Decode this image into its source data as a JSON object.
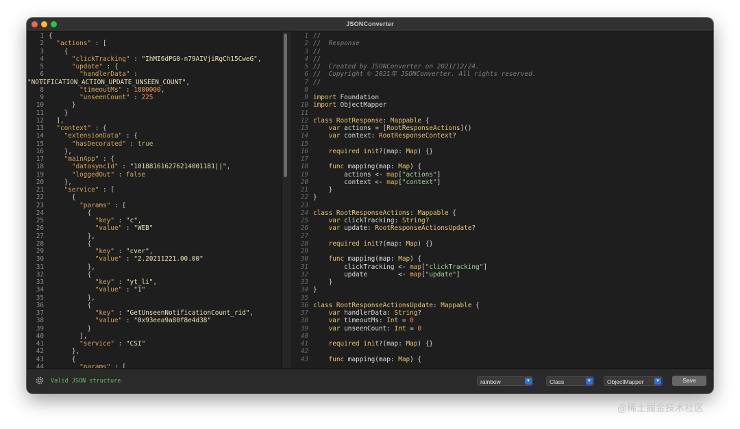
{
  "window": {
    "title": "JSONConverter"
  },
  "json_lines": [
    [
      {
        "t": "{"
      }
    ],
    [
      {
        "t": "  "
      },
      {
        "t": "\"actions\"",
        "c": "k"
      },
      {
        "t": " : ["
      }
    ],
    [
      {
        "t": "    {"
      }
    ],
    [
      {
        "t": "      "
      },
      {
        "t": "\"clickTracking\"",
        "c": "k"
      },
      {
        "t": " : "
      },
      {
        "t": "\"IhMI6dPG0-n79AIVjiRgCh15CweG\"",
        "c": "s"
      },
      {
        "t": ","
      }
    ],
    [
      {
        "t": "      "
      },
      {
        "t": "\"update\"",
        "c": "k"
      },
      {
        "t": " : {"
      }
    ],
    [
      {
        "t": "        "
      },
      {
        "t": "\"handlerData\"",
        "c": "k"
      },
      {
        "t": " :"
      }
    ],
    [
      {
        "t": "\"NOTIFICATION_ACTION_UPDATE_UNSEEN_COUNT\"",
        "c": "s",
        "abs": 1
      },
      {
        "t": ",",
        "abs": 1
      }
    ],
    [
      {
        "t": "        "
      },
      {
        "t": "\"timeoutMs\"",
        "c": "k"
      },
      {
        "t": " : "
      },
      {
        "t": "1800000",
        "c": "n"
      },
      {
        "t": ","
      }
    ],
    [
      {
        "t": "        "
      },
      {
        "t": "\"unseenCount\"",
        "c": "k"
      },
      {
        "t": " : "
      },
      {
        "t": "225",
        "c": "n"
      }
    ],
    [
      {
        "t": "      }"
      }
    ],
    [
      {
        "t": "    }"
      }
    ],
    [
      {
        "t": "  ],"
      }
    ],
    [
      {
        "t": "  "
      },
      {
        "t": "\"context\"",
        "c": "k"
      },
      {
        "t": " : {"
      }
    ],
    [
      {
        "t": "    "
      },
      {
        "t": "\"extensionData\"",
        "c": "k"
      },
      {
        "t": " : {"
      }
    ],
    [
      {
        "t": "      "
      },
      {
        "t": "\"hasDecorated\"",
        "c": "k"
      },
      {
        "t": " : "
      },
      {
        "t": "true",
        "c": "b"
      }
    ],
    [
      {
        "t": "    },"
      }
    ],
    [
      {
        "t": "    "
      },
      {
        "t": "\"mainApp\"",
        "c": "k"
      },
      {
        "t": " : {"
      }
    ],
    [
      {
        "t": "      "
      },
      {
        "t": "\"datasyncId\"",
        "c": "k"
      },
      {
        "t": " : "
      },
      {
        "t": "\"101881616276214001181||\"",
        "c": "s"
      },
      {
        "t": ","
      }
    ],
    [
      {
        "t": "      "
      },
      {
        "t": "\"loggedOut\"",
        "c": "k"
      },
      {
        "t": " : "
      },
      {
        "t": "false",
        "c": "b"
      }
    ],
    [
      {
        "t": "    },"
      }
    ],
    [
      {
        "t": "    "
      },
      {
        "t": "\"service\"",
        "c": "k"
      },
      {
        "t": " : ["
      }
    ],
    [
      {
        "t": "      {"
      }
    ],
    [
      {
        "t": "        "
      },
      {
        "t": "\"params\"",
        "c": "k"
      },
      {
        "t": " : ["
      }
    ],
    [
      {
        "t": "          {"
      }
    ],
    [
      {
        "t": "            "
      },
      {
        "t": "\"key\"",
        "c": "k"
      },
      {
        "t": " : "
      },
      {
        "t": "\"c\"",
        "c": "s"
      },
      {
        "t": ","
      }
    ],
    [
      {
        "t": "            "
      },
      {
        "t": "\"value\"",
        "c": "k"
      },
      {
        "t": " : "
      },
      {
        "t": "\"WEB\"",
        "c": "s"
      }
    ],
    [
      {
        "t": "          },"
      }
    ],
    [
      {
        "t": "          {"
      }
    ],
    [
      {
        "t": "            "
      },
      {
        "t": "\"key\"",
        "c": "k"
      },
      {
        "t": " : "
      },
      {
        "t": "\"cver\"",
        "c": "s"
      },
      {
        "t": ","
      }
    ],
    [
      {
        "t": "            "
      },
      {
        "t": "\"value\"",
        "c": "k"
      },
      {
        "t": " : "
      },
      {
        "t": "\"2.20211221.00.00\"",
        "c": "s"
      }
    ],
    [
      {
        "t": "          },"
      }
    ],
    [
      {
        "t": "          {"
      }
    ],
    [
      {
        "t": "            "
      },
      {
        "t": "\"key\"",
        "c": "k"
      },
      {
        "t": " : "
      },
      {
        "t": "\"yt_li\"",
        "c": "s"
      },
      {
        "t": ","
      }
    ],
    [
      {
        "t": "            "
      },
      {
        "t": "\"value\"",
        "c": "k"
      },
      {
        "t": " : "
      },
      {
        "t": "\"1\"",
        "c": "s"
      }
    ],
    [
      {
        "t": "          },"
      }
    ],
    [
      {
        "t": "          {"
      }
    ],
    [
      {
        "t": "            "
      },
      {
        "t": "\"key\"",
        "c": "k"
      },
      {
        "t": " : "
      },
      {
        "t": "\"GetUnseenNotificationCount_rid\"",
        "c": "s"
      },
      {
        "t": ","
      }
    ],
    [
      {
        "t": "            "
      },
      {
        "t": "\"value\"",
        "c": "k"
      },
      {
        "t": " : "
      },
      {
        "t": "\"0x93eea9a80f8e4d38\"",
        "c": "s"
      }
    ],
    [
      {
        "t": "          }"
      }
    ],
    [
      {
        "t": "        ],"
      }
    ],
    [
      {
        "t": "        "
      },
      {
        "t": "\"service\"",
        "c": "k"
      },
      {
        "t": " : "
      },
      {
        "t": "\"CSI\"",
        "c": "s"
      }
    ],
    [
      {
        "t": "      },"
      }
    ],
    [
      {
        "t": "      {"
      }
    ],
    [
      {
        "t": "        "
      },
      {
        "t": "\"params\"",
        "c": "k"
      },
      {
        "t": " : ["
      }
    ]
  ],
  "swift_lines": [
    [
      {
        "t": "//",
        "c": "cm"
      }
    ],
    [
      {
        "t": "//  Response",
        "c": "cm"
      }
    ],
    [
      {
        "t": "//",
        "c": "cm"
      }
    ],
    [
      {
        "t": "//",
        "c": "cm"
      }
    ],
    [
      {
        "t": "//  Created by JSONConverter on 2021/12/24.",
        "c": "cm"
      }
    ],
    [
      {
        "t": "//  Copyright © 2021年 JSONConverter. All rights reserved.",
        "c": "cm"
      }
    ],
    [
      {
        "t": "//",
        "c": "cm"
      }
    ],
    [],
    [
      {
        "t": "import",
        "c": "kw"
      },
      {
        "t": " Foundation"
      }
    ],
    [
      {
        "t": "import",
        "c": "kw"
      },
      {
        "t": " ObjectMapper"
      }
    ],
    [],
    [
      {
        "t": "class",
        "c": "kw"
      },
      {
        "t": " "
      },
      {
        "t": "RootResponse",
        "c": "ty"
      },
      {
        "t": ": "
      },
      {
        "t": "Mappable",
        "c": "ty"
      },
      {
        "t": " {"
      }
    ],
    [
      {
        "t": "    "
      },
      {
        "t": "var",
        "c": "kw"
      },
      {
        "t": " actions = ["
      },
      {
        "t": "RootResponseActions",
        "c": "ty"
      },
      {
        "t": "]()"
      }
    ],
    [
      {
        "t": "    "
      },
      {
        "t": "var",
        "c": "kw"
      },
      {
        "t": " context: "
      },
      {
        "t": "RootResponseContext",
        "c": "ty"
      },
      {
        "t": "?"
      }
    ],
    [],
    [
      {
        "t": "    "
      },
      {
        "t": "required",
        "c": "kw"
      },
      {
        "t": " "
      },
      {
        "t": "init",
        "c": "kw"
      },
      {
        "t": "?(map: "
      },
      {
        "t": "Map",
        "c": "ty"
      },
      {
        "t": ") {}"
      }
    ],
    [],
    [
      {
        "t": "    "
      },
      {
        "t": "func",
        "c": "kw"
      },
      {
        "t": " mapping(map: "
      },
      {
        "t": "Map",
        "c": "ty"
      },
      {
        "t": ") {"
      }
    ],
    [
      {
        "t": "        actions <- "
      },
      {
        "t": "map",
        "c": "fn"
      },
      {
        "t": "["
      },
      {
        "t": "\"actions\"",
        "c": "st"
      },
      {
        "t": "]"
      }
    ],
    [
      {
        "t": "        context <- "
      },
      {
        "t": "map",
        "c": "fn"
      },
      {
        "t": "["
      },
      {
        "t": "\"context\"",
        "c": "st"
      },
      {
        "t": "]"
      }
    ],
    [
      {
        "t": "    }"
      }
    ],
    [
      {
        "t": "}"
      }
    ],
    [],
    [
      {
        "t": "class",
        "c": "kw"
      },
      {
        "t": " "
      },
      {
        "t": "RootResponseActions",
        "c": "ty"
      },
      {
        "t": ": "
      },
      {
        "t": "Mappable",
        "c": "ty"
      },
      {
        "t": " {"
      }
    ],
    [
      {
        "t": "    "
      },
      {
        "t": "var",
        "c": "kw"
      },
      {
        "t": " clickTracking: "
      },
      {
        "t": "String",
        "c": "ty"
      },
      {
        "t": "?"
      }
    ],
    [
      {
        "t": "    "
      },
      {
        "t": "var",
        "c": "kw"
      },
      {
        "t": " update: "
      },
      {
        "t": "RootResponseActionsUpdate",
        "c": "ty"
      },
      {
        "t": "?"
      }
    ],
    [],
    [
      {
        "t": "    "
      },
      {
        "t": "required",
        "c": "kw"
      },
      {
        "t": " "
      },
      {
        "t": "init",
        "c": "kw"
      },
      {
        "t": "?(map: "
      },
      {
        "t": "Map",
        "c": "ty"
      },
      {
        "t": ") {}"
      }
    ],
    [],
    [
      {
        "t": "    "
      },
      {
        "t": "func",
        "c": "kw"
      },
      {
        "t": " mapping(map: "
      },
      {
        "t": "Map",
        "c": "ty"
      },
      {
        "t": ") {"
      }
    ],
    [
      {
        "t": "        clickTracking <- "
      },
      {
        "t": "map",
        "c": "fn"
      },
      {
        "t": "["
      },
      {
        "t": "\"clickTracking\"",
        "c": "st"
      },
      {
        "t": "]"
      }
    ],
    [
      {
        "t": "        update        <- "
      },
      {
        "t": "map",
        "c": "fn"
      },
      {
        "t": "["
      },
      {
        "t": "\"update\"",
        "c": "st"
      },
      {
        "t": "]"
      }
    ],
    [
      {
        "t": "    }"
      }
    ],
    [
      {
        "t": "}"
      }
    ],
    [],
    [
      {
        "t": "class",
        "c": "kw"
      },
      {
        "t": " "
      },
      {
        "t": "RootResponseActionsUpdate",
        "c": "ty"
      },
      {
        "t": ": "
      },
      {
        "t": "Mappable",
        "c": "ty"
      },
      {
        "t": " {"
      }
    ],
    [
      {
        "t": "    "
      },
      {
        "t": "var",
        "c": "kw"
      },
      {
        "t": " handlerData: "
      },
      {
        "t": "String",
        "c": "ty"
      },
      {
        "t": "?"
      }
    ],
    [
      {
        "t": "    "
      },
      {
        "t": "var",
        "c": "kw"
      },
      {
        "t": " timeoutMs: "
      },
      {
        "t": "Int",
        "c": "ty"
      },
      {
        "t": " = "
      },
      {
        "t": "0",
        "c": "nb"
      }
    ],
    [
      {
        "t": "    "
      },
      {
        "t": "var",
        "c": "kw"
      },
      {
        "t": " unseenCount: "
      },
      {
        "t": "Int",
        "c": "ty"
      },
      {
        "t": " = "
      },
      {
        "t": "0",
        "c": "nb"
      }
    ],
    [],
    [
      {
        "t": "    "
      },
      {
        "t": "required",
        "c": "kw"
      },
      {
        "t": " "
      },
      {
        "t": "init",
        "c": "kw"
      },
      {
        "t": "?(map: "
      },
      {
        "t": "Map",
        "c": "ty"
      },
      {
        "t": ") {}"
      }
    ],
    [],
    [
      {
        "t": "    "
      },
      {
        "t": "func",
        "c": "kw"
      },
      {
        "t": " mapping(map: "
      },
      {
        "t": "Map",
        "c": "ty"
      },
      {
        "t": ") {"
      }
    ]
  ],
  "status": {
    "text": "Valid JSON structure"
  },
  "toolbar": {
    "theme_value": "rainbow",
    "struct_value": "Class",
    "framework_value": "ObjectMapper",
    "save_label": "Save"
  },
  "watermark": "@稀土掘金技术社区",
  "colors": {
    "background": "#1e1e1e",
    "status_green": "#63c266",
    "select_arrow_blue": "#2f6fe0",
    "json_key": "#d8a657",
    "json_number": "#f09a55",
    "swift_keyword": "#e7c46d",
    "swift_string": "#a7d29a"
  }
}
